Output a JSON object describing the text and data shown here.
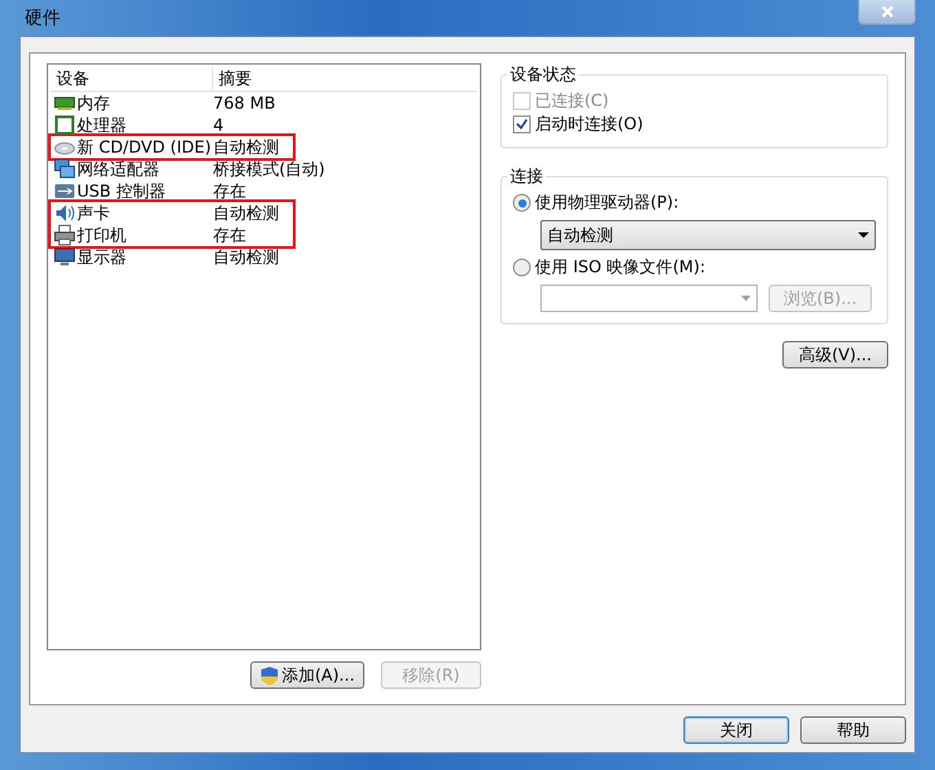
{
  "window": {
    "title": "硬件"
  },
  "device_table": {
    "columns": [
      "设备",
      "摘要"
    ],
    "rows": [
      {
        "kind": "memory",
        "device": "内存",
        "summary": "768 MB",
        "highlighted": false
      },
      {
        "kind": "cpu",
        "device": "处理器",
        "summary": "4",
        "highlighted": false
      },
      {
        "kind": "cdrom",
        "device": "新 CD/DVD (IDE)",
        "summary": "自动检测",
        "highlighted": true
      },
      {
        "kind": "network",
        "device": "网络适配器",
        "summary": "桥接模式(自动)",
        "highlighted": false
      },
      {
        "kind": "usb",
        "device": "USB 控制器",
        "summary": "存在",
        "highlighted": false
      },
      {
        "kind": "sound",
        "device": "声卡",
        "summary": "自动检测",
        "highlighted": true
      },
      {
        "kind": "printer",
        "device": "打印机",
        "summary": "存在",
        "highlighted": true
      },
      {
        "kind": "display",
        "device": "显示器",
        "summary": "自动检测",
        "highlighted": false
      }
    ]
  },
  "device_status": {
    "title": "设备状态",
    "options": [
      {
        "label": "已连接(C)",
        "checked": false,
        "disabled": true
      },
      {
        "label": "启动时连接(O)",
        "checked": true,
        "disabled": false
      }
    ]
  },
  "connection": {
    "title": "连接",
    "physical": {
      "label": "使用物理驱动器(P):",
      "selected": true,
      "dropdown": "自动检测"
    },
    "iso": {
      "label": "使用 ISO 映像文件(M):",
      "selected": false,
      "browse": "浏览(B)..."
    }
  },
  "advanced_button": "高级(V)...",
  "add_button": "添加(A)...",
  "remove_button": {
    "label": "移除(R)",
    "disabled": true
  },
  "footer_buttons": [
    {
      "label": "关闭",
      "default": true
    },
    {
      "label": "帮助",
      "default": false
    }
  ]
}
